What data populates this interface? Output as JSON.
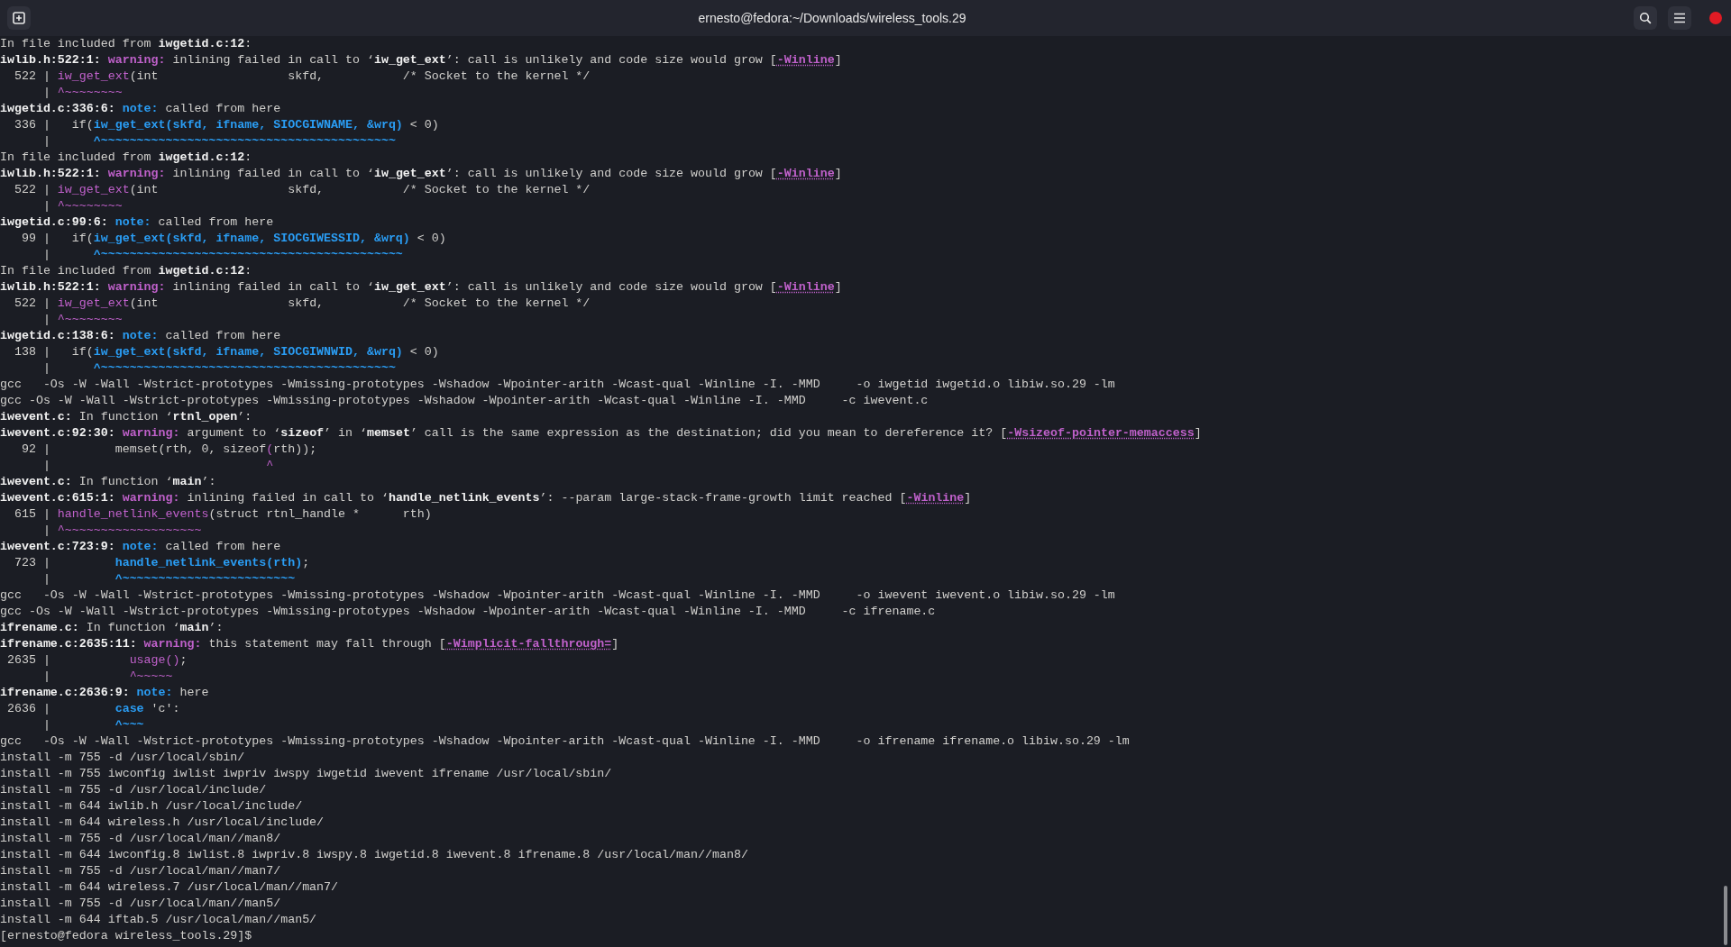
{
  "window": {
    "title": "ernesto@fedora:~/Downloads/wireless_tools.29"
  },
  "lines": [
    {
      "segments": [
        {
          "kind": "plain",
          "text": "In file included from "
        },
        {
          "kind": "bold",
          "text": "iwgetid.c:12"
        },
        {
          "kind": "plain",
          "text": ":"
        }
      ]
    },
    {
      "segments": [
        {
          "kind": "bold",
          "text": "iwlib.h:522:1: "
        },
        {
          "kind": "warning",
          "text": "warning:"
        },
        {
          "kind": "plain",
          "text": " inlining failed in call to ‘"
        },
        {
          "kind": "bold",
          "text": "iw_get_ext"
        },
        {
          "kind": "plain",
          "text": "’: call is unlikely and code size would grow ["
        },
        {
          "kind": "flag",
          "text": "-Winline"
        },
        {
          "kind": "plain",
          "text": "]"
        }
      ]
    },
    {
      "segments": [
        {
          "kind": "plain",
          "text": "  522 | "
        },
        {
          "kind": "purple",
          "text": "iw_get_ext"
        },
        {
          "kind": "plain",
          "text": "(int                  skfd,           /* Socket to the kernel */"
        }
      ]
    },
    {
      "segments": [
        {
          "kind": "plain",
          "text": "      | "
        },
        {
          "kind": "purple",
          "text": "^~~~~~~~~"
        }
      ]
    },
    {
      "segments": [
        {
          "kind": "bold",
          "text": "iwgetid.c:336:6: "
        },
        {
          "kind": "note",
          "text": "note:"
        },
        {
          "kind": "plain",
          "text": " called from here"
        }
      ]
    },
    {
      "segments": [
        {
          "kind": "plain",
          "text": "  336 |   if("
        },
        {
          "kind": "blue",
          "text": "iw_get_ext(skfd, ifname, SIOCGIWNAME, &wrq)"
        },
        {
          "kind": "plain",
          "text": " < 0)"
        }
      ]
    },
    {
      "segments": [
        {
          "kind": "plain",
          "text": "      |      "
        },
        {
          "kind": "blue",
          "text": "^~~~~~~~~~~~~~~~~~~~~~~~~~~~~~~~~~~~~~~~~~"
        }
      ]
    },
    {
      "segments": [
        {
          "kind": "plain",
          "text": "In file included from "
        },
        {
          "kind": "bold",
          "text": "iwgetid.c:12"
        },
        {
          "kind": "plain",
          "text": ":"
        }
      ]
    },
    {
      "segments": [
        {
          "kind": "bold",
          "text": "iwlib.h:522:1: "
        },
        {
          "kind": "warning",
          "text": "warning:"
        },
        {
          "kind": "plain",
          "text": " inlining failed in call to ‘"
        },
        {
          "kind": "bold",
          "text": "iw_get_ext"
        },
        {
          "kind": "plain",
          "text": "’: call is unlikely and code size would grow ["
        },
        {
          "kind": "flag",
          "text": "-Winline"
        },
        {
          "kind": "plain",
          "text": "]"
        }
      ]
    },
    {
      "segments": [
        {
          "kind": "plain",
          "text": "  522 | "
        },
        {
          "kind": "purple",
          "text": "iw_get_ext"
        },
        {
          "kind": "plain",
          "text": "(int                  skfd,           /* Socket to the kernel */"
        }
      ]
    },
    {
      "segments": [
        {
          "kind": "plain",
          "text": "      | "
        },
        {
          "kind": "purple",
          "text": "^~~~~~~~~"
        }
      ]
    },
    {
      "segments": [
        {
          "kind": "bold",
          "text": "iwgetid.c:99:6: "
        },
        {
          "kind": "note",
          "text": "note:"
        },
        {
          "kind": "plain",
          "text": " called from here"
        }
      ]
    },
    {
      "segments": [
        {
          "kind": "plain",
          "text": "   99 |   if("
        },
        {
          "kind": "blue",
          "text": "iw_get_ext(skfd, ifname, SIOCGIWESSID, &wrq)"
        },
        {
          "kind": "plain",
          "text": " < 0)"
        }
      ]
    },
    {
      "segments": [
        {
          "kind": "plain",
          "text": "      |      "
        },
        {
          "kind": "blue",
          "text": "^~~~~~~~~~~~~~~~~~~~~~~~~~~~~~~~~~~~~~~~~~~"
        }
      ]
    },
    {
      "segments": [
        {
          "kind": "plain",
          "text": "In file included from "
        },
        {
          "kind": "bold",
          "text": "iwgetid.c:12"
        },
        {
          "kind": "plain",
          "text": ":"
        }
      ]
    },
    {
      "segments": [
        {
          "kind": "bold",
          "text": "iwlib.h:522:1: "
        },
        {
          "kind": "warning",
          "text": "warning:"
        },
        {
          "kind": "plain",
          "text": " inlining failed in call to ‘"
        },
        {
          "kind": "bold",
          "text": "iw_get_ext"
        },
        {
          "kind": "plain",
          "text": "’: call is unlikely and code size would grow ["
        },
        {
          "kind": "flag",
          "text": "-Winline"
        },
        {
          "kind": "plain",
          "text": "]"
        }
      ]
    },
    {
      "segments": [
        {
          "kind": "plain",
          "text": "  522 | "
        },
        {
          "kind": "purple",
          "text": "iw_get_ext"
        },
        {
          "kind": "plain",
          "text": "(int                  skfd,           /* Socket to the kernel */"
        }
      ]
    },
    {
      "segments": [
        {
          "kind": "plain",
          "text": "      | "
        },
        {
          "kind": "purple",
          "text": "^~~~~~~~~"
        }
      ]
    },
    {
      "segments": [
        {
          "kind": "bold",
          "text": "iwgetid.c:138:6: "
        },
        {
          "kind": "note",
          "text": "note:"
        },
        {
          "kind": "plain",
          "text": " called from here"
        }
      ]
    },
    {
      "segments": [
        {
          "kind": "plain",
          "text": "  138 |   if("
        },
        {
          "kind": "blue",
          "text": "iw_get_ext(skfd, ifname, SIOCGIWNWID, &wrq)"
        },
        {
          "kind": "plain",
          "text": " < 0)"
        }
      ]
    },
    {
      "segments": [
        {
          "kind": "plain",
          "text": "      |      "
        },
        {
          "kind": "blue",
          "text": "^~~~~~~~~~~~~~~~~~~~~~~~~~~~~~~~~~~~~~~~~~"
        }
      ]
    },
    {
      "segments": [
        {
          "kind": "plain",
          "text": "gcc   -Os -W -Wall -Wstrict-prototypes -Wmissing-prototypes -Wshadow -Wpointer-arith -Wcast-qual -Winline -I. -MMD     -o iwgetid iwgetid.o libiw.so.29 -lm"
        }
      ]
    },
    {
      "segments": [
        {
          "kind": "plain",
          "text": "gcc -Os -W -Wall -Wstrict-prototypes -Wmissing-prototypes -Wshadow -Wpointer-arith -Wcast-qual -Winline -I. -MMD     -c iwevent.c"
        }
      ]
    },
    {
      "segments": [
        {
          "kind": "bold",
          "text": "iwevent.c:"
        },
        {
          "kind": "plain",
          "text": " In function ‘"
        },
        {
          "kind": "bold",
          "text": "rtnl_open"
        },
        {
          "kind": "plain",
          "text": "’:"
        }
      ]
    },
    {
      "segments": [
        {
          "kind": "bold",
          "text": "iwevent.c:92:30: "
        },
        {
          "kind": "warning",
          "text": "warning:"
        },
        {
          "kind": "plain",
          "text": " argument to ‘"
        },
        {
          "kind": "bold",
          "text": "sizeof"
        },
        {
          "kind": "plain",
          "text": "’ in ‘"
        },
        {
          "kind": "bold",
          "text": "memset"
        },
        {
          "kind": "plain",
          "text": "’ call is the same expression as the destination; did you mean to dereference it? ["
        },
        {
          "kind": "flag",
          "text": "-Wsizeof-pointer-memaccess"
        },
        {
          "kind": "plain",
          "text": "]"
        }
      ]
    },
    {
      "segments": [
        {
          "kind": "plain",
          "text": "   92 |         memset(rth, 0, sizeof"
        },
        {
          "kind": "purple",
          "text": "("
        },
        {
          "kind": "plain",
          "text": "rth));"
        }
      ]
    },
    {
      "segments": [
        {
          "kind": "plain",
          "text": "      |                              "
        },
        {
          "kind": "purple",
          "text": "^"
        }
      ]
    },
    {
      "segments": [
        {
          "kind": "bold",
          "text": "iwevent.c:"
        },
        {
          "kind": "plain",
          "text": " In function ‘"
        },
        {
          "kind": "bold",
          "text": "main"
        },
        {
          "kind": "plain",
          "text": "’:"
        }
      ]
    },
    {
      "segments": [
        {
          "kind": "bold",
          "text": "iwevent.c:615:1: "
        },
        {
          "kind": "warning",
          "text": "warning:"
        },
        {
          "kind": "plain",
          "text": " inlining failed in call to ‘"
        },
        {
          "kind": "bold",
          "text": "handle_netlink_events"
        },
        {
          "kind": "plain",
          "text": "’: --param large-stack-frame-growth limit reached ["
        },
        {
          "kind": "flag",
          "text": "-Winline"
        },
        {
          "kind": "plain",
          "text": "]"
        }
      ]
    },
    {
      "segments": [
        {
          "kind": "plain",
          "text": "  615 | "
        },
        {
          "kind": "purple",
          "text": "handle_netlink_events"
        },
        {
          "kind": "plain",
          "text": "(struct rtnl_handle *      rth)"
        }
      ]
    },
    {
      "segments": [
        {
          "kind": "plain",
          "text": "      | "
        },
        {
          "kind": "purple",
          "text": "^~~~~~~~~~~~~~~~~~~~"
        }
      ]
    },
    {
      "segments": [
        {
          "kind": "bold",
          "text": "iwevent.c:723:9: "
        },
        {
          "kind": "note",
          "text": "note:"
        },
        {
          "kind": "plain",
          "text": " called from here"
        }
      ]
    },
    {
      "segments": [
        {
          "kind": "plain",
          "text": "  723 |         "
        },
        {
          "kind": "blue",
          "text": "handle_netlink_events(rth)"
        },
        {
          "kind": "plain",
          "text": ";"
        }
      ]
    },
    {
      "segments": [
        {
          "kind": "plain",
          "text": "      |         "
        },
        {
          "kind": "blue",
          "text": "^~~~~~~~~~~~~~~~~~~~~~~~~"
        }
      ]
    },
    {
      "segments": [
        {
          "kind": "plain",
          "text": "gcc   -Os -W -Wall -Wstrict-prototypes -Wmissing-prototypes -Wshadow -Wpointer-arith -Wcast-qual -Winline -I. -MMD     -o iwevent iwevent.o libiw.so.29 -lm"
        }
      ]
    },
    {
      "segments": [
        {
          "kind": "plain",
          "text": "gcc -Os -W -Wall -Wstrict-prototypes -Wmissing-prototypes -Wshadow -Wpointer-arith -Wcast-qual -Winline -I. -MMD     -c ifrename.c"
        }
      ]
    },
    {
      "segments": [
        {
          "kind": "bold",
          "text": "ifrename.c:"
        },
        {
          "kind": "plain",
          "text": " In function ‘"
        },
        {
          "kind": "bold",
          "text": "main"
        },
        {
          "kind": "plain",
          "text": "’:"
        }
      ]
    },
    {
      "segments": [
        {
          "kind": "bold",
          "text": "ifrename.c:2635:11: "
        },
        {
          "kind": "warning",
          "text": "warning:"
        },
        {
          "kind": "plain",
          "text": " this statement may fall through ["
        },
        {
          "kind": "flag",
          "text": "-Wimplicit-fallthrough="
        },
        {
          "kind": "plain",
          "text": "]"
        }
      ]
    },
    {
      "segments": [
        {
          "kind": "plain",
          "text": " 2635 |           "
        },
        {
          "kind": "purple",
          "text": "usage()"
        },
        {
          "kind": "plain",
          "text": ";"
        }
      ]
    },
    {
      "segments": [
        {
          "kind": "plain",
          "text": "      |           "
        },
        {
          "kind": "purple",
          "text": "^~~~~~"
        }
      ]
    },
    {
      "segments": [
        {
          "kind": "bold",
          "text": "ifrename.c:2636:9: "
        },
        {
          "kind": "note",
          "text": "note:"
        },
        {
          "kind": "plain",
          "text": " here"
        }
      ]
    },
    {
      "segments": [
        {
          "kind": "plain",
          "text": " 2636 |         "
        },
        {
          "kind": "blue",
          "text": "case"
        },
        {
          "kind": "plain",
          "text": " 'c':"
        }
      ]
    },
    {
      "segments": [
        {
          "kind": "plain",
          "text": "      |         "
        },
        {
          "kind": "blue",
          "text": "^~~~"
        }
      ]
    },
    {
      "segments": [
        {
          "kind": "plain",
          "text": "gcc   -Os -W -Wall -Wstrict-prototypes -Wmissing-prototypes -Wshadow -Wpointer-arith -Wcast-qual -Winline -I. -MMD     -o ifrename ifrename.o libiw.so.29 -lm"
        }
      ]
    },
    {
      "segments": [
        {
          "kind": "plain",
          "text": "install -m 755 -d /usr/local/sbin/"
        }
      ]
    },
    {
      "segments": [
        {
          "kind": "plain",
          "text": "install -m 755 iwconfig iwlist iwpriv iwspy iwgetid iwevent ifrename /usr/local/sbin/"
        }
      ]
    },
    {
      "segments": [
        {
          "kind": "plain",
          "text": "install -m 755 -d /usr/local/include/"
        }
      ]
    },
    {
      "segments": [
        {
          "kind": "plain",
          "text": "install -m 644 iwlib.h /usr/local/include/"
        }
      ]
    },
    {
      "segments": [
        {
          "kind": "plain",
          "text": "install -m 644 wireless.h /usr/local/include/"
        }
      ]
    },
    {
      "segments": [
        {
          "kind": "plain",
          "text": "install -m 755 -d /usr/local/man//man8/"
        }
      ]
    },
    {
      "segments": [
        {
          "kind": "plain",
          "text": "install -m 644 iwconfig.8 iwlist.8 iwpriv.8 iwspy.8 iwgetid.8 iwevent.8 ifrename.8 /usr/local/man//man8/"
        }
      ]
    },
    {
      "segments": [
        {
          "kind": "plain",
          "text": "install -m 755 -d /usr/local/man//man7/"
        }
      ]
    },
    {
      "segments": [
        {
          "kind": "plain",
          "text": "install -m 644 wireless.7 /usr/local/man//man7/"
        }
      ]
    },
    {
      "segments": [
        {
          "kind": "plain",
          "text": "install -m 755 -d /usr/local/man//man5/"
        }
      ]
    },
    {
      "segments": [
        {
          "kind": "plain",
          "text": "install -m 644 iftab.5 /usr/local/man//man5/"
        }
      ]
    },
    {
      "segments": [
        {
          "kind": "plain",
          "text": "[ernesto@fedora wireless_tools.29]$"
        }
      ]
    }
  ]
}
